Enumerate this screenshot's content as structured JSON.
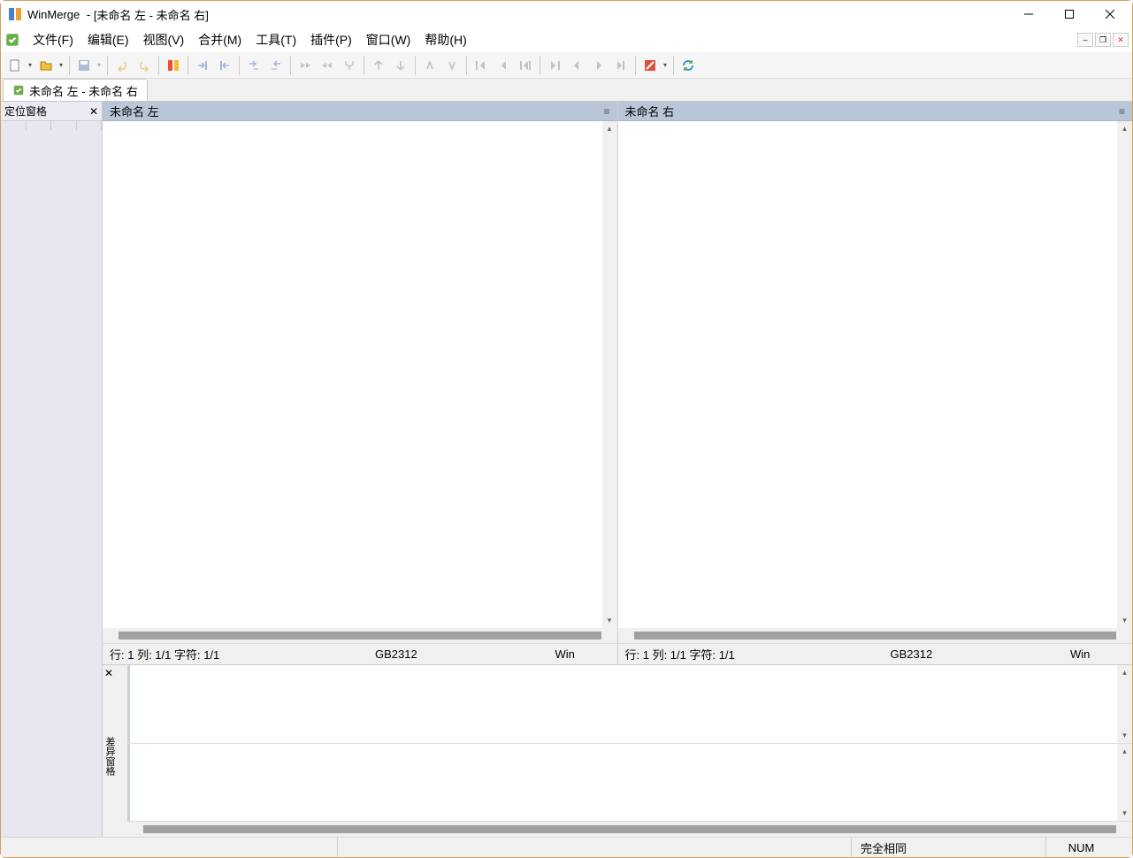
{
  "titlebar": {
    "app": "WinMerge",
    "doc": "[未命名 左 - 未命名 右]"
  },
  "menus": [
    "文件(F)",
    "编辑(E)",
    "视图(V)",
    "合并(M)",
    "工具(T)",
    "插件(P)",
    "窗口(W)",
    "帮助(H)"
  ],
  "doctab": "未命名 左 - 未命名 右",
  "location_pane": {
    "title": "定位窗格"
  },
  "left_pane": {
    "title": "未命名 左",
    "content": "",
    "status_pos": "行: 1  列: 1/1  字符: 1/1",
    "encoding": "GB2312",
    "eol": "Win"
  },
  "right_pane": {
    "title": "未命名 右",
    "content": "",
    "status_pos": "行: 1  列: 1/1  字符: 1/1",
    "encoding": "GB2312",
    "eol": "Win"
  },
  "diff_pane": {
    "label": "差异窗格"
  },
  "statusbar": {
    "msg": "",
    "diff_status": "完全相同",
    "num": "NUM"
  }
}
